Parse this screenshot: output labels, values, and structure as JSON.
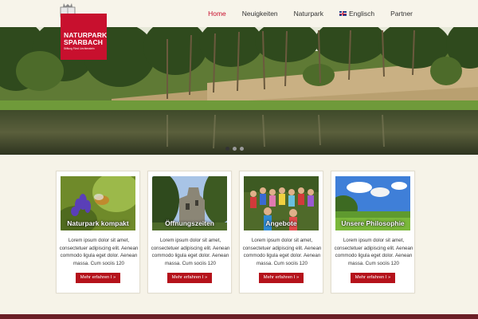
{
  "brand": {
    "line1": "NATURPARK",
    "line2": "SPARBACH",
    "sub": "Stiftung Fürst Liechtenstein",
    "color": "#c8102e"
  },
  "nav": {
    "items": [
      {
        "label": "Home",
        "active": true
      },
      {
        "label": "Neuigkeiten"
      },
      {
        "label": "Naturpark"
      },
      {
        "label": "Englisch",
        "icon": "uk-flag-icon"
      },
      {
        "label": "Partner"
      }
    ]
  },
  "slider": {
    "slides": 3,
    "active_index": 0
  },
  "cards": [
    {
      "title": "Naturpark kompakt",
      "text": "Lorem ipsum dolor sit amet, consectetuer adipiscing elit. Aenean commodo ligula eget dolor. Aenean massa. Cum sociis 120",
      "button": "Mehr erfahren I »"
    },
    {
      "title": "Öffnungszeiten",
      "text": "Lorem ipsum dolor sit amet, consectetuer adipiscing elit. Aenean commodo ligula eget dolor. Aenean massa. Cum sociis 120",
      "button": "Mehr erfahren I »"
    },
    {
      "title": "Angebote",
      "text": "Lorem ipsum dolor sit amet, consectetuer adipiscing elit. Aenean commodo ligula eget dolor. Aenean massa. Cum sociis 120",
      "button": "Mehr erfahren I »"
    },
    {
      "title": "Unsere Philosophie",
      "text": "Lorem ipsum dolor sit amet, consectetuer adipiscing elit. Aenean commodo ligula eget dolor. Aenean massa. Cum sociis 120",
      "button": "Mehr erfahren I »"
    }
  ],
  "colors": {
    "accent": "#c8102e",
    "button": "#b5121b",
    "page_bg": "#f6f3e8",
    "footer": "#6b1f26"
  }
}
